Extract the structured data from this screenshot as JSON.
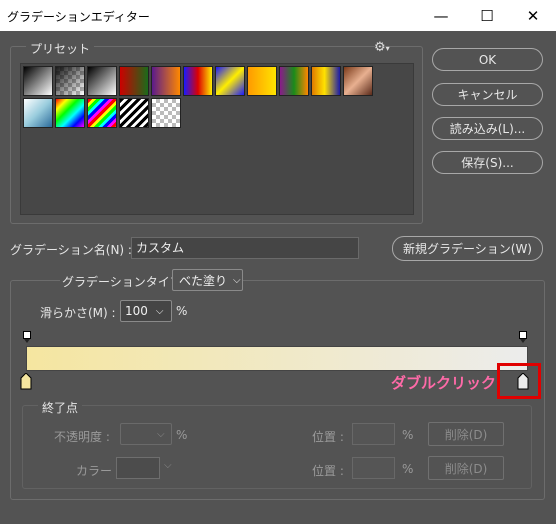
{
  "window": {
    "title": "グラデーションエディター",
    "minimize": "—",
    "maximize": "☐",
    "close": "✕"
  },
  "presets": {
    "legend": "プリセット",
    "gear_icon": "gear-icon",
    "swatches": [
      "linear-gradient(135deg,#000 0%,#fff 100%)",
      "checker-dark",
      "linear-gradient(135deg,#000 0%,#fff 100%)",
      "linear-gradient(90deg,#c00 0%,#1a6b1a 100%)",
      "linear-gradient(90deg,#5a1a8c 0%,#ff8800 100%)",
      "linear-gradient(90deg,#1a1aff 0%,#d00 50%,#ffee00 100%)",
      "linear-gradient(135deg,#1a1aff 0%,#ffee00 50%,#1a1aff 100%)",
      "linear-gradient(90deg,#ff9a00 0%,#ffe400 100%)",
      "linear-gradient(90deg,#8b1a8b 0%,#1a8b1a 50%,#ff8800 100%)",
      "linear-gradient(90deg,#e07a00 0%,#ffe200 45%,#1a1aaa 100%)",
      "linear-gradient(135deg,#7a3a1a 0%,#e8b090 50%,#5a2a1a 100%)",
      "linear-gradient(135deg,#fff 0%,#9cd 50%,#2a6a9a 100%)",
      "linear-gradient(135deg,#f00 0%,#ff0 20%,#0f0 40%,#0ff 60%,#00f 80%,#f0f 100%)",
      "stripes-rainbow",
      "stripes-bw",
      "checker"
    ]
  },
  "buttons": {
    "ok": "OK",
    "cancel": "キャンセル",
    "load": "読み込み(L)...",
    "save": "保存(S)...",
    "new_gradient": "新規グラデーション(W)"
  },
  "name_field": {
    "label": "グラデーション名(N) :",
    "value": "カスタム"
  },
  "gradient_type": {
    "label": "グラデーションタイプ :",
    "value": "べた塗り"
  },
  "smoothness": {
    "label": "滑らかさ(M) :",
    "value": "100",
    "unit": "%"
  },
  "gradient": {
    "color_start": "#f5e6a0",
    "color_end": "#ececec",
    "annotation": "ダブルクリック",
    "annotation_color": "#ff6aa8",
    "highlight_color": "#e00000"
  },
  "stops_group": {
    "legend": "終了点",
    "opacity_label": "不透明度 :",
    "opacity_unit": "%",
    "location_label_1": "位置 :",
    "location_unit_1": "%",
    "delete_1": "削除(D)",
    "color_label": "カラー :",
    "location_label_2": "位置 :",
    "location_unit_2": "%",
    "delete_2": "削除(D)"
  }
}
